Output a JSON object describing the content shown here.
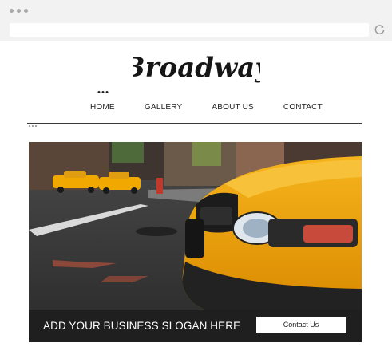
{
  "logo": {
    "text": "Broadway"
  },
  "nav": {
    "items": [
      {
        "label": "HOME",
        "active": true
      },
      {
        "label": "GALLERY",
        "active": false
      },
      {
        "label": "ABOUT US",
        "active": false
      },
      {
        "label": "CONTACT",
        "active": false
      }
    ]
  },
  "hero": {
    "slogan": "ADD YOUR BUSINESS SLOGAN HERE",
    "cta_label": "Contact Us"
  },
  "colors": {
    "band": "#1f1f1f",
    "taxi": "#f2a900",
    "chrome": "#f2f2f2"
  },
  "icons": [
    "window-dots-icon",
    "reload-icon"
  ]
}
